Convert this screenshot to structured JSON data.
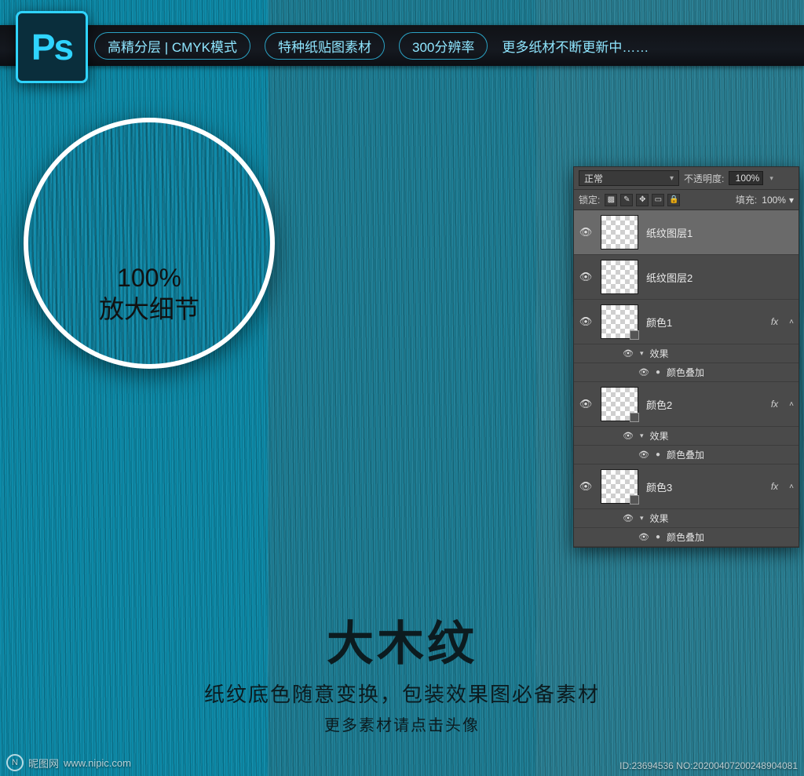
{
  "top": {
    "pill1": "高精分层 | CMYK模式",
    "pill2": "特种纸贴图素材",
    "pill3": "300分辨率",
    "trail": "更多纸材不断更新中……"
  },
  "ps_icon_text": "Ps",
  "zoom": {
    "line1": "100%",
    "line2": "放大细节"
  },
  "layers_panel": {
    "blend_mode": "正常",
    "opacity_label": "不透明度:",
    "opacity_value": "100%",
    "lock_label": "锁定:",
    "fill_label": "填充:",
    "fill_value": "100%",
    "layers": [
      {
        "name": "纸纹图层1",
        "selected": true,
        "trans": true,
        "fx": false
      },
      {
        "name": "纸纹图层2",
        "selected": false,
        "trans": true,
        "fx": false
      },
      {
        "name": "颜色1",
        "selected": false,
        "trans": true,
        "fx": true,
        "fx_label": "效果",
        "fx_item": "颜色叠加"
      },
      {
        "name": "颜色2",
        "selected": false,
        "trans": true,
        "fx": true,
        "fx_label": "效果",
        "fx_item": "颜色叠加"
      },
      {
        "name": "颜色3",
        "selected": false,
        "trans": true,
        "fx": true,
        "fx_label": "效果",
        "fx_item": "颜色叠加"
      }
    ],
    "fx_badge": "fx"
  },
  "bottom": {
    "title": "大木纹",
    "sub": "纸纹底色随意变换，包装效果图必备素材",
    "sub2": "更多素材请点击头像"
  },
  "watermark": {
    "site_cn": "昵图网",
    "site_url": "www.nipic.com",
    "meta": "ID:23694536 NO:20200407200248904081"
  }
}
